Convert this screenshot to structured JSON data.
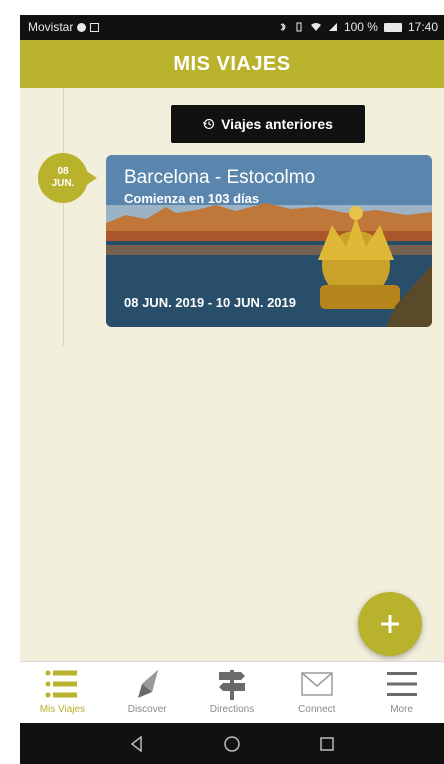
{
  "status_bar": {
    "carrier": "Movistar",
    "battery": "100 %",
    "time": "17:40"
  },
  "header": {
    "title": "MIS VIAJES"
  },
  "previous_trips_button": {
    "label": "Viajes anteriores"
  },
  "trip": {
    "date_day": "08",
    "date_month": "JUN.",
    "title": "Barcelona - Estocolmo",
    "subtitle": "Comienza en 103 días",
    "dates": "08 JUN. 2019 - 10 JUN. 2019"
  },
  "bottom_nav": {
    "items": [
      {
        "label": "Mis Viajes",
        "icon": "list-icon",
        "active": true
      },
      {
        "label": "Discover",
        "icon": "compass-icon",
        "active": false
      },
      {
        "label": "Directions",
        "icon": "signpost-icon",
        "active": false
      },
      {
        "label": "Connect",
        "icon": "envelope-icon",
        "active": false
      },
      {
        "label": "More",
        "icon": "menu-icon",
        "active": false
      }
    ]
  },
  "colors": {
    "accent": "#b9b22d",
    "background": "#f2efdd",
    "dark": "#111111"
  }
}
